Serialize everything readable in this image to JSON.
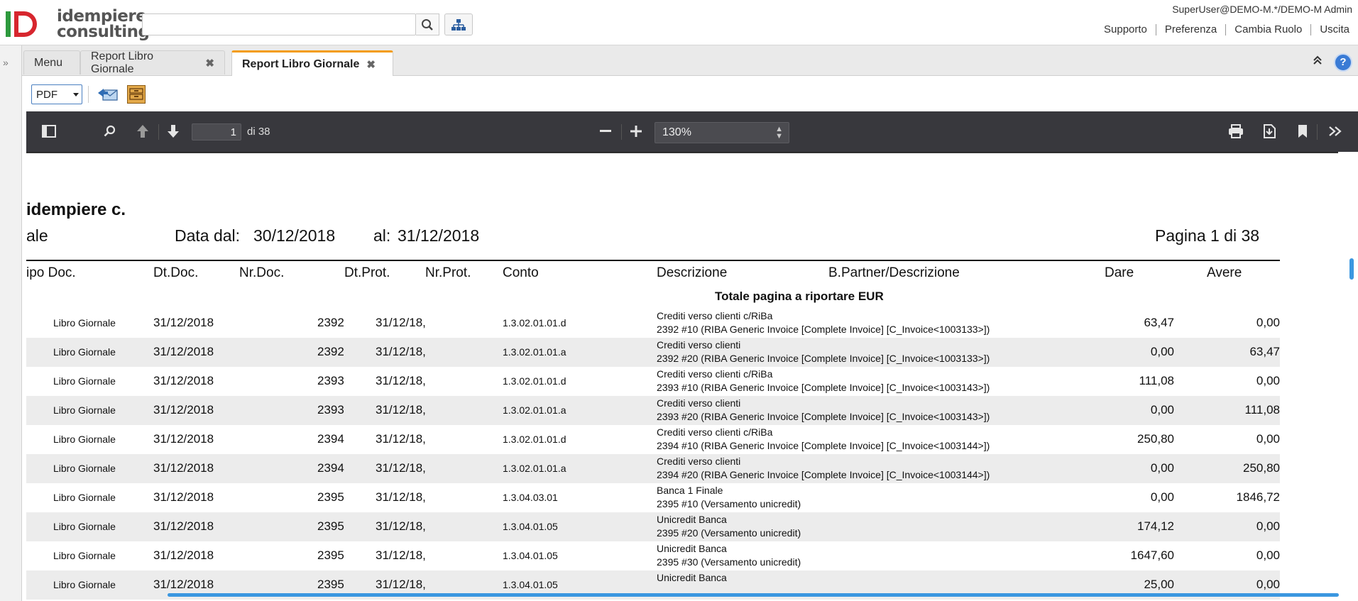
{
  "header": {
    "logo_line1": "idempiere",
    "logo_line2": "consulting",
    "search_value": "",
    "user": "SuperUser@DEMO-M.*/DEMO-M Admin",
    "links": [
      "Supporto",
      "Preferenza",
      "Cambia Ruolo",
      "Uscita"
    ]
  },
  "tabs": [
    {
      "label": "Menu",
      "closable": false
    },
    {
      "label": "Report Libro Giornale",
      "closable": true
    },
    {
      "label": "Report Libro Giornale",
      "closable": true,
      "active": true
    }
  ],
  "toolbar": {
    "format": "PDF"
  },
  "pdf": {
    "page": "1",
    "of": "di 38",
    "zoom": "130%"
  },
  "report": {
    "company": "idempiere c.",
    "title_fragment": "ale",
    "from_label": "Data dal:",
    "from_date": "30/12/2018",
    "to_label": "al:",
    "to_date": "31/12/2018",
    "page_label": "Pagina 1 di 38",
    "columns": [
      "ipo Doc.",
      "Dt.Doc.",
      "Nr.Doc.",
      "Dt.Prot.",
      "Nr.Prot.",
      "Conto",
      "Descrizione",
      "B.Partner/Descrizione",
      "Dare",
      "Avere"
    ],
    "totale": "Totale pagina a riportare EUR",
    "rows": [
      {
        "tipo": "Libro Giornale",
        "dt": "31/12/2018",
        "nr": "2392",
        "dp": "31/12/18,",
        "conto": "1.3.02.01.01.d",
        "d1": "Crediti verso clienti c/RiBa",
        "d2": "2392 #10 (RIBA Generic Invoice [Complete Invoice] [C_Invoice<1003133>])",
        "dare": "63,47",
        "avere": "0,00"
      },
      {
        "tipo": "Libro Giornale",
        "dt": "31/12/2018",
        "nr": "2392",
        "dp": "31/12/18,",
        "conto": "1.3.02.01.01.a",
        "d1": "Crediti verso clienti",
        "d2": "2392 #20 (RIBA Generic Invoice [Complete Invoice] [C_Invoice<1003133>])",
        "dare": "0,00",
        "avere": "63,47"
      },
      {
        "tipo": "Libro Giornale",
        "dt": "31/12/2018",
        "nr": "2393",
        "dp": "31/12/18,",
        "conto": "1.3.02.01.01.d",
        "d1": "Crediti verso clienti c/RiBa",
        "d2": "2393 #10 (RIBA Generic Invoice [Complete Invoice] [C_Invoice<1003143>])",
        "dare": "111,08",
        "avere": "0,00"
      },
      {
        "tipo": "Libro Giornale",
        "dt": "31/12/2018",
        "nr": "2393",
        "dp": "31/12/18,",
        "conto": "1.3.02.01.01.a",
        "d1": "Crediti verso clienti",
        "d2": "2393 #20 (RIBA Generic Invoice [Complete Invoice] [C_Invoice<1003143>])",
        "dare": "0,00",
        "avere": "111,08"
      },
      {
        "tipo": "Libro Giornale",
        "dt": "31/12/2018",
        "nr": "2394",
        "dp": "31/12/18,",
        "conto": "1.3.02.01.01.d",
        "d1": "Crediti verso clienti c/RiBa",
        "d2": "2394 #10 (RIBA Generic Invoice [Complete Invoice] [C_Invoice<1003144>])",
        "dare": "250,80",
        "avere": "0,00"
      },
      {
        "tipo": "Libro Giornale",
        "dt": "31/12/2018",
        "nr": "2394",
        "dp": "31/12/18,",
        "conto": "1.3.02.01.01.a",
        "d1": "Crediti verso clienti",
        "d2": "2394 #20 (RIBA Generic Invoice [Complete Invoice] [C_Invoice<1003144>])",
        "dare": "0,00",
        "avere": "250,80"
      },
      {
        "tipo": "Libro Giornale",
        "dt": "31/12/2018",
        "nr": "2395",
        "dp": "31/12/18,",
        "conto": "1.3.04.03.01",
        "d1": "Banca 1 Finale",
        "d2": "2395 #10 (Versamento unicredit)",
        "dare": "0,00",
        "avere": "1846,72"
      },
      {
        "tipo": "Libro Giornale",
        "dt": "31/12/2018",
        "nr": "2395",
        "dp": "31/12/18,",
        "conto": "1.3.04.01.05",
        "d1": "Unicredit Banca",
        "d2": "2395 #20 (Versamento unicredit)",
        "dare": "174,12",
        "avere": "0,00"
      },
      {
        "tipo": "Libro Giornale",
        "dt": "31/12/2018",
        "nr": "2395",
        "dp": "31/12/18,",
        "conto": "1.3.04.01.05",
        "d1": "Unicredit Banca",
        "d2": "2395 #30 (Versamento unicredit)",
        "dare": "1647,60",
        "avere": "0,00"
      },
      {
        "tipo": "Libro Giornale",
        "dt": "31/12/2018",
        "nr": "2395",
        "dp": "31/12/18,",
        "conto": "1.3.04.01.05",
        "d1": "Unicredit Banca",
        "d2": "",
        "dare": "25,00",
        "avere": "0,00"
      }
    ]
  },
  "colors": {
    "accent_tab": "#f39c12",
    "logo_green": "#2e9a3e",
    "logo_red": "#d7262e",
    "pdf_toolbar": "#38383d",
    "scroll_blue": "#3b97e0",
    "alt_row": "#ececec"
  }
}
